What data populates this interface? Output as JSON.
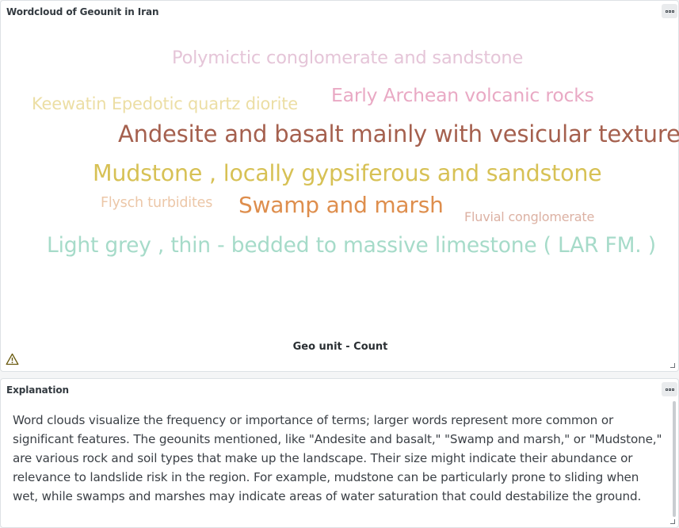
{
  "wordcloud_panel": {
    "title": "Wordcloud of Geounit in Iran",
    "footer_label": "Geo unit - Count",
    "menu_icon": "more-options-icon",
    "warning_icon": "warning-triangle-icon",
    "resize_icon": "resize-handle-icon",
    "words": [
      {
        "text": "Polymictic conglomerate and sandstone",
        "color": "#e5c5d8"
      },
      {
        "text": "Early Archean volcanic rocks",
        "color": "#e9a9c4"
      },
      {
        "text": "Keewatin Epedotic quartz diorite",
        "color": "#ecdea4"
      },
      {
        "text": "Andesite and basalt mainly with vesicular texture",
        "color": "#a5604e"
      },
      {
        "text": "Mudstone , locally gypsiferous and sandstone",
        "color": "#d7c155"
      },
      {
        "text": "Flysch turbidites",
        "color": "#ecc7a8"
      },
      {
        "text": "Swamp and marsh",
        "color": "#de8e4d"
      },
      {
        "text": "Fluvial conglomerate",
        "color": "#dcb1a3"
      },
      {
        "text": "Light grey , thin - bedded to massive limestone ( LAR FM. )",
        "color": "#a6dbc9"
      }
    ]
  },
  "explanation_panel": {
    "title": "Explanation",
    "menu_icon": "more-options-icon",
    "resize_icon": "resize-handle-icon",
    "text": "Word clouds visualize the frequency or importance of terms; larger words represent more common or significant features. The geounits mentioned, like \"Andesite and basalt,\" \"Swamp and marsh,\" or \"Mudstone,\" are various rock and soil types that make up the landscape. Their size might indicate their abundance or relevance to landslide risk in the region. For example, mudstone can be particularly prone to sliding when wet, while swamps and marshes may indicate areas of water saturation that could destabilize the ground."
  }
}
